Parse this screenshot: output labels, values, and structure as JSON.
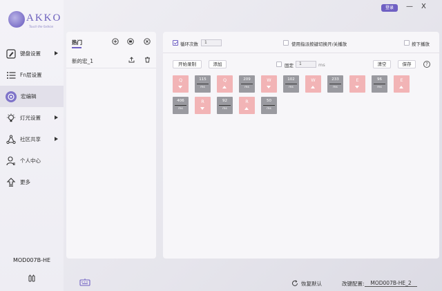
{
  "brand": {
    "logo_text": "AKKO",
    "logo_sub": "Touch the fashion",
    "accent": "#6f60c3"
  },
  "window": {
    "login_label": "登录",
    "minimize": "—",
    "close": "X"
  },
  "sidebar": {
    "items": [
      {
        "label": "键盘设置",
        "icon": "keyboard-icon",
        "arrow": true
      },
      {
        "label": "Fn层设置",
        "icon": "list-icon",
        "arrow": false
      },
      {
        "label": "宏编辑",
        "icon": "macro-icon",
        "arrow": false,
        "active": true
      },
      {
        "label": "灯光设置",
        "icon": "lightbulb-icon",
        "arrow": true
      },
      {
        "label": "社区共享",
        "icon": "share-icon",
        "arrow": true
      },
      {
        "label": "个人中心",
        "icon": "user-icon",
        "arrow": false
      },
      {
        "label": "更多",
        "icon": "upload-icon",
        "arrow": false
      }
    ],
    "device_name": "MOD007B-HE"
  },
  "macro_list": {
    "header": "热门",
    "items": [
      {
        "label": "新的宏_1"
      }
    ]
  },
  "editor": {
    "loop_label": "循环次数",
    "loop_checked": true,
    "loop_count": "1",
    "toggle_label": "使用指派按键切换开/关播放",
    "press_label": "按下播放",
    "record_button": "开始录制",
    "add_button": "添加",
    "fixed_label": "固定",
    "fixed_value": "1",
    "fixed_unit": "ms",
    "clear_button": "清空",
    "save_button": "保存",
    "help": "?",
    "unit": "ms",
    "tiles": [
      {
        "kind": "key",
        "label": "Q",
        "dir": "down"
      },
      {
        "kind": "delay",
        "label": "115"
      },
      {
        "kind": "key",
        "label": "Q",
        "dir": "up"
      },
      {
        "kind": "delay",
        "label": "209"
      },
      {
        "kind": "key",
        "label": "W",
        "dir": "down"
      },
      {
        "kind": "delay",
        "label": "102"
      },
      {
        "kind": "key",
        "label": "W",
        "dir": "up"
      },
      {
        "kind": "delay",
        "label": "233"
      },
      {
        "kind": "key",
        "label": "E",
        "dir": "down"
      },
      {
        "kind": "delay",
        "label": "96"
      },
      {
        "kind": "key",
        "label": "E",
        "dir": "up"
      },
      {
        "kind": "delay",
        "label": "406"
      },
      {
        "kind": "key",
        "label": "R",
        "dir": "down"
      },
      {
        "kind": "delay",
        "label": "92"
      },
      {
        "kind": "key",
        "label": "R",
        "dir": "up"
      },
      {
        "kind": "delay",
        "label": "50"
      }
    ]
  },
  "footer": {
    "reset_label": "恢复默认",
    "config_label": "改键配置:",
    "config_value": "MOD007B-HE_2"
  }
}
